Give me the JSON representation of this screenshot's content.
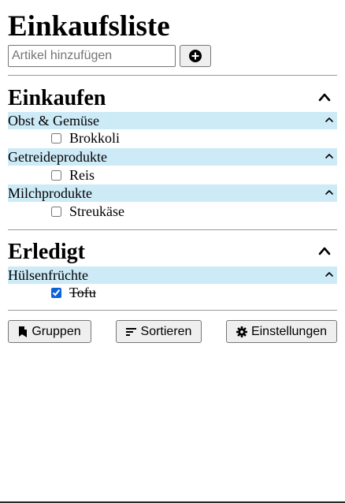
{
  "app": {
    "title": "Einkaufsliste"
  },
  "add_item": {
    "placeholder": "Artikel hinzufügen",
    "value": "",
    "button_icon": "plus-circle-icon"
  },
  "sections": [
    {
      "title": "Einkaufen",
      "collapse_icon": "chevron-up-icon",
      "groups": [
        {
          "label": "Obst & Gemüse",
          "items": [
            {
              "label": "Brokkoli",
              "checked": false
            }
          ]
        },
        {
          "label": "Getreideprodukte",
          "items": [
            {
              "label": "Reis",
              "checked": false
            }
          ]
        },
        {
          "label": "Milchprodukte",
          "items": [
            {
              "label": "Streukäse",
              "checked": false
            }
          ]
        }
      ]
    },
    {
      "title": "Erledigt",
      "collapse_icon": "chevron-up-icon",
      "groups": [
        {
          "label": "Hülsenfrüchte",
          "items": [
            {
              "label": "Tofu",
              "checked": true
            }
          ]
        }
      ]
    }
  ],
  "footer": {
    "groups_label": "Gruppen",
    "sort_label": "Sortieren",
    "settings_label": "Einstellungen"
  },
  "colors": {
    "group_header_bg": "#cdeaf7",
    "checkbox_accent": "#0b63d8"
  }
}
